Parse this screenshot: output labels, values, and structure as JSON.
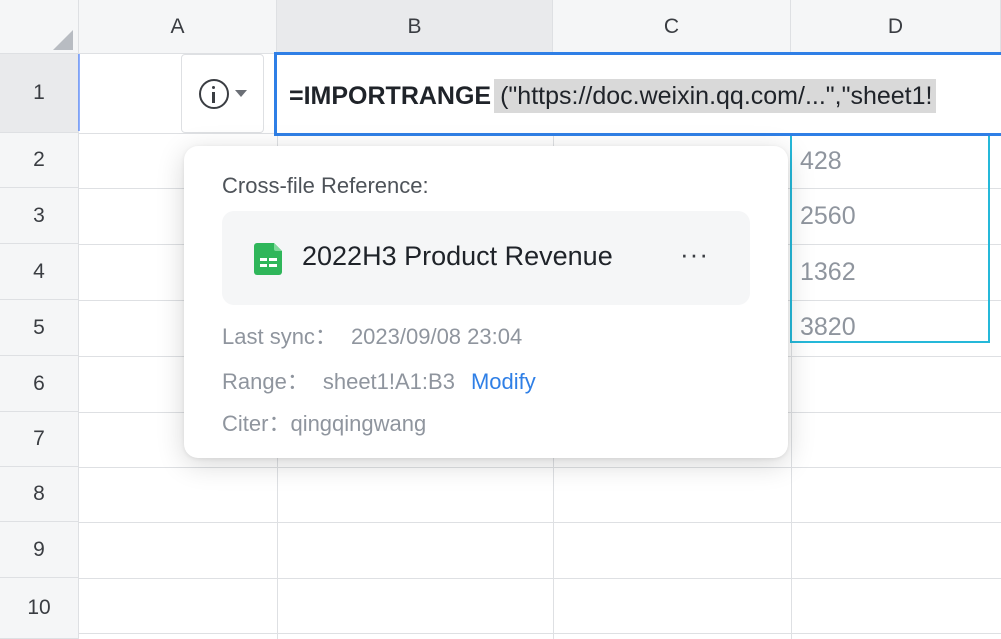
{
  "columns": [
    "A",
    "B",
    "C",
    "D"
  ],
  "rows": [
    "1",
    "2",
    "3",
    "4",
    "5",
    "6",
    "7",
    "8",
    "9",
    "10"
  ],
  "formula": {
    "function": "=IMPORTRANGE",
    "arguments": "(\"https://doc.weixin.qq.com/...\",\"sheet1!"
  },
  "column_d_values": [
    "428",
    "2560",
    "1362",
    "3820"
  ],
  "popover": {
    "title": "Cross-file Reference:",
    "file_name": "2022H3 Product Revenue",
    "more_label": "···",
    "last_sync_label": "Last sync：",
    "last_sync_value": "2023/09/08 23:04",
    "range_label": "Range：",
    "range_value": "sheet1!A1:B3",
    "modify_label": "Modify",
    "citer_label": "Citer：",
    "citer_value": "qingqingwang"
  },
  "colors": {
    "accent": "#2f7fe6",
    "range_highlight": "#25b8d9",
    "sheet_icon": "#2fb65a"
  },
  "icons": {
    "info": "info-icon",
    "dropdown": "chevron-down-icon",
    "file": "spreadsheet-icon",
    "more": "more-icon",
    "select_all": "select-all-icon"
  }
}
